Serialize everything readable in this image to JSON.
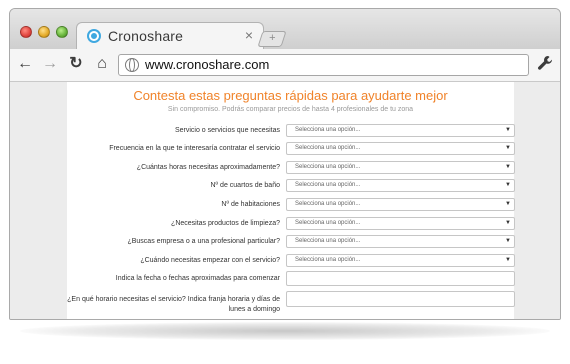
{
  "browser": {
    "tab_title": "Cronoshare",
    "tab_close": "×",
    "new_tab": "+",
    "url": "www.cronoshare.com",
    "nav": {
      "back": "←",
      "forward": "→",
      "reload": "↻",
      "home": "⌂",
      "menu": "🔧"
    }
  },
  "form": {
    "heading": "Contesta estas preguntas rápidas para ayudarte mejor",
    "subheading": "Sin compromiso. Podrás comparar precios de hasta 4 profesionales de tu zona",
    "select_placeholder": "Selecciona una opción...",
    "questions": [
      {
        "label": "Servicio o servicios que necesitas"
      },
      {
        "label": "Frecuencia en la que te interesaría contratar el servicio"
      },
      {
        "label": "¿Cuántas horas necesitas aproximadamente?"
      },
      {
        "label": "Nº de cuartos de baño"
      },
      {
        "label": "Nº de habitaciones"
      },
      {
        "label": "¿Necesitas productos de limpieza?"
      },
      {
        "label": "¿Buscas empresa o a una profesional particular?"
      },
      {
        "label": "¿Cuándo necesitas empezar con el servicio?"
      },
      {
        "label": "Indica la fecha o fechas aproximadas para comenzar"
      },
      {
        "label": "¿En qué horario necesitas el servicio? Indica franja horaria y días de lunes a domingo"
      }
    ]
  },
  "colors": {
    "accent": "#f0832a",
    "tab_icon": "#3fa8e0"
  }
}
